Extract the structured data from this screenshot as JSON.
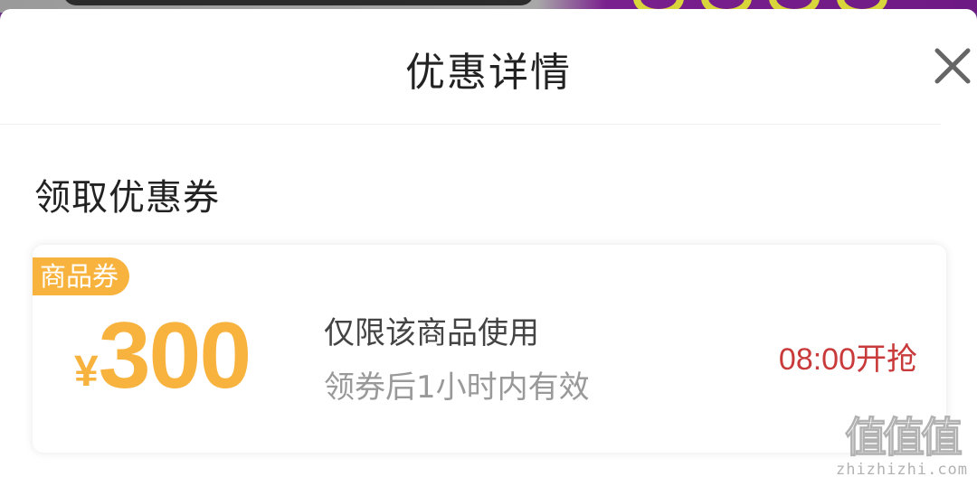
{
  "modal": {
    "title": "优惠详情",
    "close_icon": "close-icon"
  },
  "section": {
    "title": "领取优惠券"
  },
  "coupon": {
    "badge": "商品券",
    "currency": "¥",
    "amount": "300",
    "description": "仅限该商品使用",
    "validity": "领券后1小时内有效",
    "start_time": "08:00开抢",
    "colors": {
      "accent": "#f8b33e",
      "start_text": "#c93a3a"
    }
  },
  "watermark": {
    "logo": "值值值",
    "site": "zhizhizhi.com"
  }
}
